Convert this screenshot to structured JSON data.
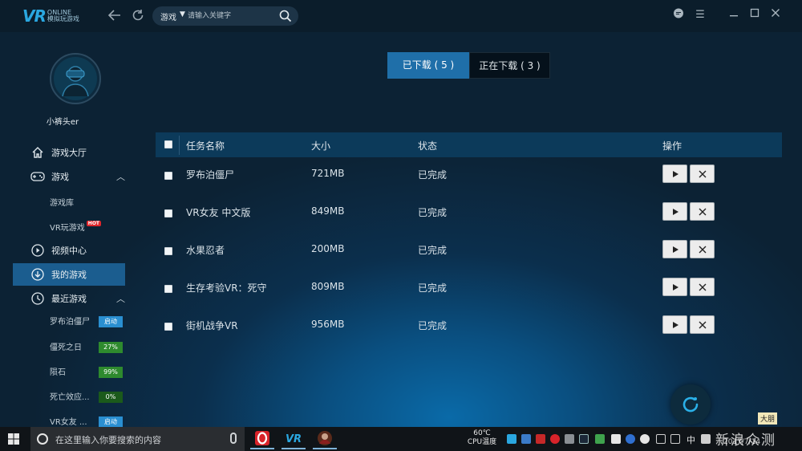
{
  "app": {
    "logo_vr": "VR",
    "logo_online": "ONLINE",
    "logo_sub": "模拟玩游戏"
  },
  "search": {
    "category": "游戏",
    "placeholder": "请输入关键字"
  },
  "sidebar": {
    "username": "小裤头er",
    "items": [
      {
        "label": "游戏大厅",
        "icon": "home-icon"
      },
      {
        "label": "游戏",
        "icon": "gamepad-icon"
      },
      {
        "label": "视频中心",
        "icon": "play-circle-icon"
      },
      {
        "label": "我的游戏",
        "icon": "download-circle-icon"
      },
      {
        "label": "最近游戏",
        "icon": "clock-icon"
      }
    ],
    "game_sub": [
      "游戏库",
      "VR玩游戏"
    ],
    "hot_badge": "HOT",
    "recent": [
      {
        "name": "罗布泊僵尸",
        "status": "启动",
        "color": "#2a8fd1"
      },
      {
        "name": "僵死之日",
        "status": "27%",
        "color": "#2e8a2e"
      },
      {
        "name": "陨石",
        "status": "99%",
        "color": "#2e8a2e"
      },
      {
        "name": "死亡效应...",
        "status": "0%",
        "color": "#2e8a2e"
      },
      {
        "name": "VR女友 ...",
        "status": "启动",
        "color": "#2a8fd1"
      }
    ]
  },
  "tabs": {
    "downloaded": "已下载 ( 5 )",
    "downloading": "正在下载 ( 3 )"
  },
  "table": {
    "headers": {
      "name": "任务名称",
      "size": "大小",
      "status": "状态",
      "actions": "操作"
    },
    "rows": [
      {
        "name": "罗布泊僵尸",
        "size": "721MB",
        "status": "已完成"
      },
      {
        "name": "VR女友 中文版",
        "size": "849MB",
        "status": "已完成"
      },
      {
        "name": "水果忍者",
        "size": "200MB",
        "status": "已完成"
      },
      {
        "name": "生存考验VR：死守",
        "size": "809MB",
        "status": "已完成"
      },
      {
        "name": "街机战争VR",
        "size": "956MB",
        "status": "已完成"
      }
    ]
  },
  "overlay": {
    "watermark_label": "大朋",
    "watermark_site": "新浪众测"
  },
  "taskbar": {
    "search_placeholder": "在这里输入你要搜索的内容",
    "temp_value": "60℃",
    "temp_label": "CPU温度",
    "ime": "中",
    "date": "2017/7/14"
  }
}
